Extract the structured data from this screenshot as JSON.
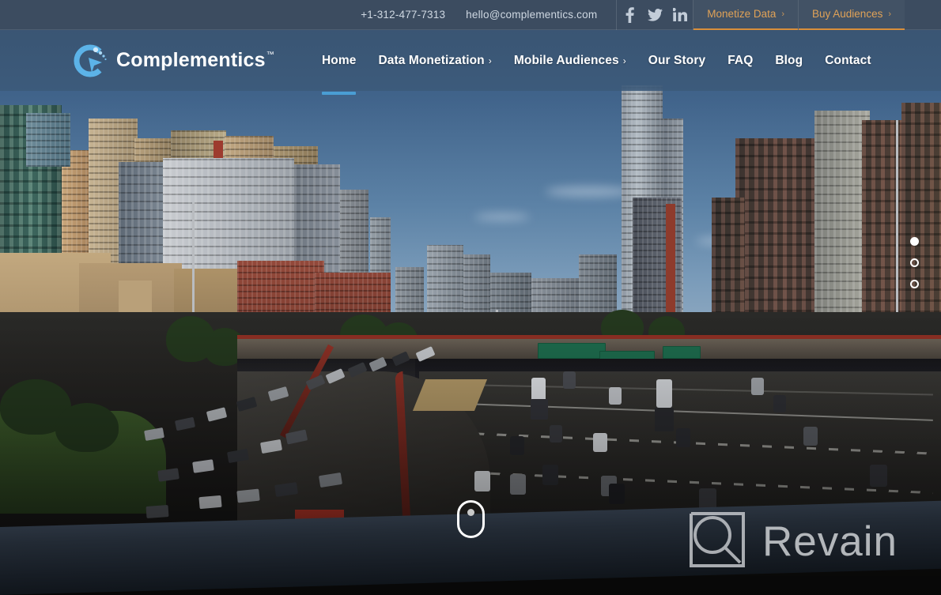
{
  "topbar": {
    "phone": "+1-312-477-7313",
    "email": "hello@complementics.com",
    "social": [
      {
        "name": "facebook-icon",
        "label": "Facebook"
      },
      {
        "name": "twitter-icon",
        "label": "Twitter"
      },
      {
        "name": "linkedin-icon",
        "label": "LinkedIn"
      }
    ],
    "ctas": [
      {
        "label": "Monetize Data",
        "chevron": "›"
      },
      {
        "label": "Buy Audiences",
        "chevron": "›"
      }
    ],
    "background_color": "#3c4c60",
    "cta_color": "#e0a257",
    "cta_underline_color": "#d98f3a"
  },
  "header": {
    "logo_text": "Complementics",
    "logo_tm": "™",
    "logo_icon": "complementics-logo-icon",
    "logo_color": "#5cb3e8",
    "background_color": "#3a5573",
    "nav": [
      {
        "label": "Home",
        "chevron": "",
        "active": true
      },
      {
        "label": "Data Monetization",
        "chevron": "›",
        "active": false
      },
      {
        "label": "Mobile Audiences",
        "chevron": "›",
        "active": false
      },
      {
        "label": "Our Story",
        "chevron": "",
        "active": false
      },
      {
        "label": "FAQ",
        "chevron": "",
        "active": false
      },
      {
        "label": "Blog",
        "chevron": "",
        "active": false
      },
      {
        "label": "Contact",
        "chevron": "",
        "active": false
      }
    ],
    "active_underline_color": "#4a9ed4"
  },
  "hero": {
    "image_description": "Aerial photograph of a Chicago downtown skyline with a multi-lane expressway and traffic below",
    "slider_dots": [
      {
        "name": "slide-dot-1",
        "active": true
      },
      {
        "name": "slide-dot-2",
        "active": false
      },
      {
        "name": "slide-dot-3",
        "active": false
      }
    ],
    "scroll_indicator": "scroll-down-indicator"
  },
  "watermark": {
    "text": "Revain",
    "icon": "revain-logo-icon",
    "color": "#d5d8db"
  }
}
